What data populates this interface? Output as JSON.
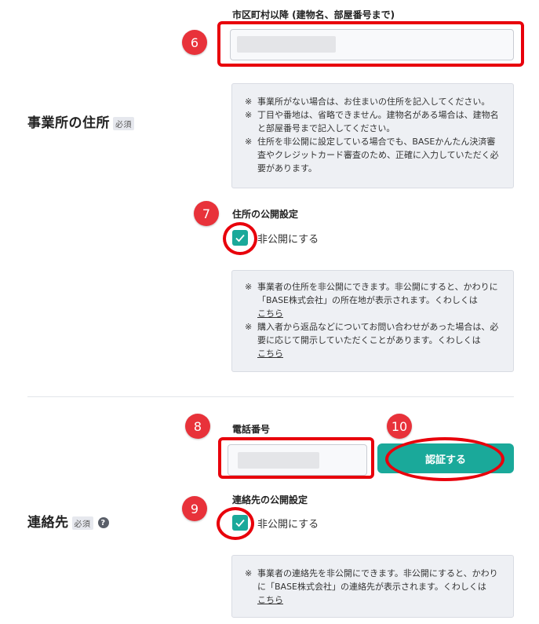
{
  "address_section": {
    "title": "事業所の住所",
    "required": "必須",
    "city_label": "市区町村以降 (建物名、部屋番号まで)",
    "note_lines": [
      {
        "mark": "※",
        "text": "事業所がない場合は、お住まいの住所を記入してください。"
      },
      {
        "mark": "※",
        "text": "丁目や番地は、省略できません。建物名がある場合は、建物名と部屋番号まで記入してください。"
      },
      {
        "mark": "※",
        "text": "住所を非公開に設定している場合でも、BASEかんたん決済審査やクレジットカード審査のため、正確に入力していただく必要があります。"
      }
    ],
    "visibility_label": "住所の公開設定",
    "private_checkbox": "非公開にする",
    "visibility_note_1": "事業者の住所を非公開にできます。非公開にすると、かわりに「BASE株式会社」の所在地が表示されます。くわしくは",
    "visibility_note_2": "購入者から返品などについてお問い合わせがあった場合は、必要に応じて開示していただくことがあります。くわしくは",
    "link": "こちら"
  },
  "contact_section": {
    "title": "連絡先",
    "required": "必須",
    "help": "?",
    "phone_label": "電話番号",
    "verify_button": "認証する",
    "visibility_label": "連絡先の公開設定",
    "private_checkbox": "非公開にする",
    "visibility_note": "事業者の連絡先を非公開にできます。非公開にすると、かわりに「BASE株式会社」の連絡先が表示されます。くわしくは",
    "link": "こちら"
  },
  "annotations": [
    "6",
    "7",
    "8",
    "9",
    "10"
  ],
  "colors": {
    "accent": "#1aa99a",
    "annotation": "#e8000b",
    "badge": "#e8323a"
  }
}
